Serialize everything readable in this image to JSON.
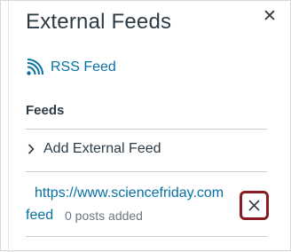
{
  "header": {
    "title": "External Feeds"
  },
  "rss": {
    "label": "RSS Feed"
  },
  "feeds": {
    "heading": "Feeds",
    "add_label": "Add External Feed",
    "items": [
      {
        "url": "https://www.sciencefriday.com",
        "link_label": "feed",
        "status": "0 posts added"
      }
    ]
  },
  "colors": {
    "link": "#0770a3",
    "text": "#2d3b45",
    "muted": "#6b7780",
    "remove_border": "#8b1a22"
  },
  "icons": {
    "close": "close-icon",
    "rss": "rss-icon",
    "chevron": "chevron-right-icon",
    "remove": "remove-icon"
  }
}
